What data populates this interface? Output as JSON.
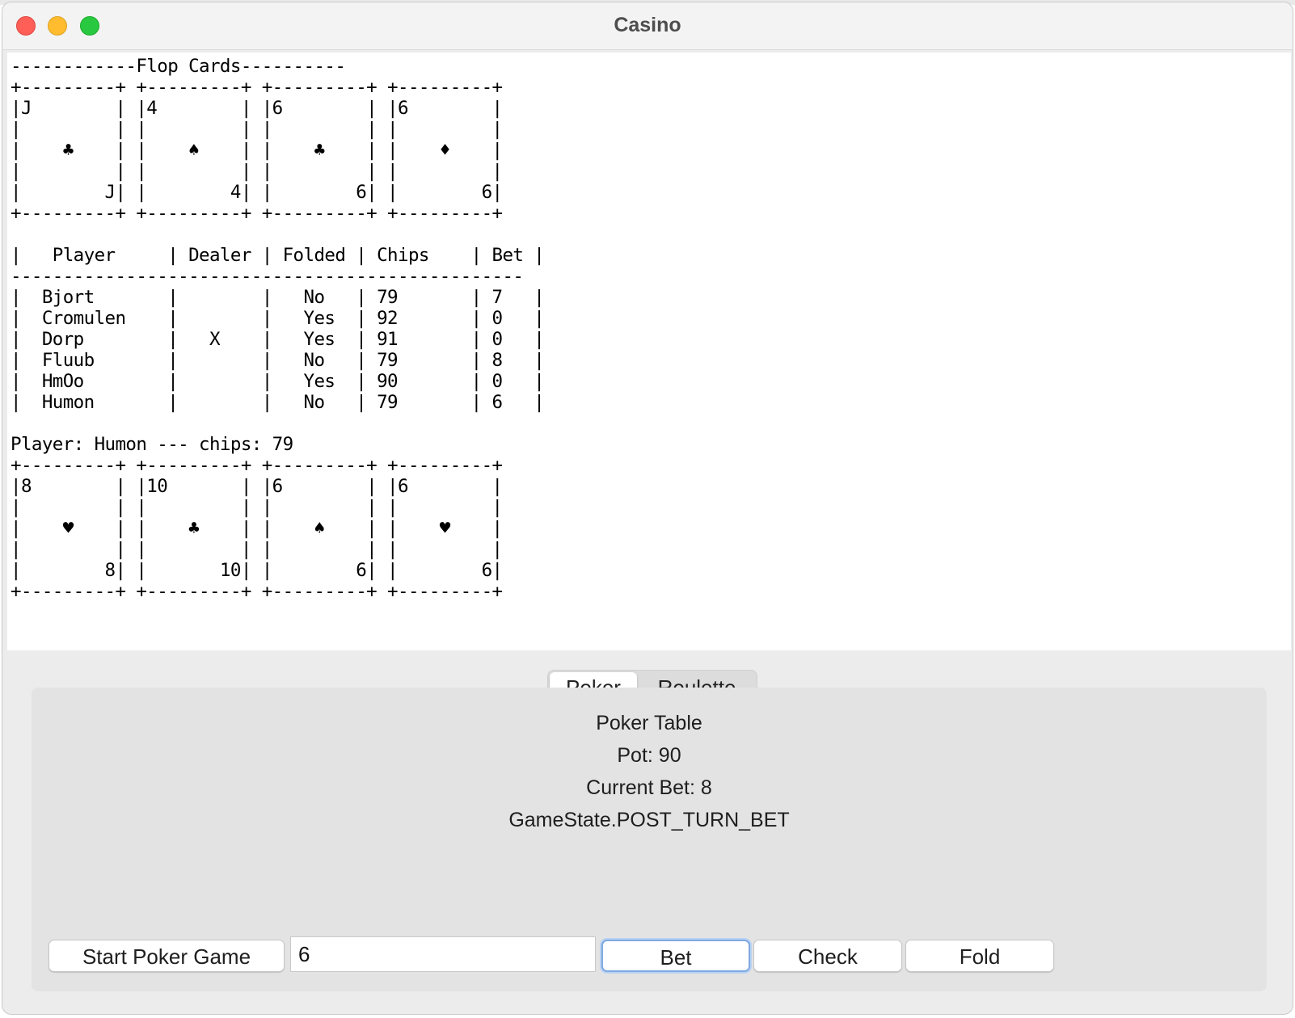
{
  "window": {
    "title": "Casino"
  },
  "console": {
    "lines": [
      "------------Flop Cards----------",
      "+---------+ +---------+ +---------+ +---------+",
      "|J        | |4        | |6        | |6        |",
      "|         | |         | |         | |         |",
      "|    ♣    | |    ♠    | |    ♣    | |    ♦    |",
      "|         | |         | |         | |         |",
      "|        J| |        4| |        6| |        6|",
      "+---------+ +---------+ +---------+ +---------+",
      "",
      "|   Player     | Dealer | Folded | Chips    | Bet |",
      "-------------------------------------------------",
      "|  Bjort       |        |   No   | 79       | 7   |",
      "|  Cromulen    |        |   Yes  | 92       | 0   |",
      "|  Dorp        |   X    |   Yes  | 91       | 0   |",
      "|  Fluub       |        |   No   | 79       | 8   |",
      "|  HmOo        |        |   Yes  | 90       | 0   |",
      "|  Humon       |        |   No   | 79       | 6   |",
      "",
      "Player: Humon --- chips: 79",
      "+---------+ +---------+ +---------+ +---------+",
      "|8        | |10       | |6        | |6        |",
      "|         | |         | |         | |         |",
      "|    ♥    | |    ♣    | |    ♠    | |    ♥    |",
      "|         | |         | |         | |         |",
      "|        8| |       10| |        6| |        6|",
      "+---------+ +---------+ +---------+ +---------+"
    ]
  },
  "tabs": [
    "Poker",
    "Roulette"
  ],
  "selected_tab": "Poker",
  "info": {
    "table_title": "Poker Table",
    "pot": "Pot: 90",
    "current_bet": "Current Bet: 8",
    "state": "GameState.POST_TURN_BET"
  },
  "controls": {
    "start_label": "Start Poker Game",
    "bet_amount": "6",
    "bet_label": "Bet",
    "check_label": "Check",
    "fold_label": "Fold"
  }
}
